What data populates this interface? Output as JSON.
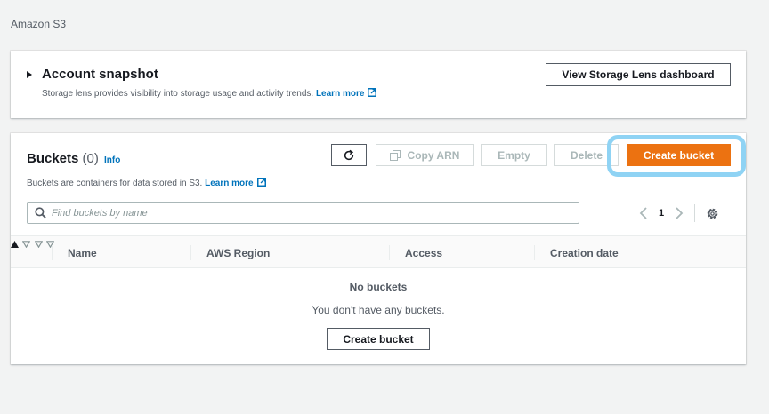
{
  "breadcrumb": "Amazon S3",
  "snapshot": {
    "title": "Account snapshot",
    "description": "Storage lens provides visibility into storage usage and activity trends.",
    "learn_more": "Learn more",
    "dashboard_button": "View Storage Lens dashboard"
  },
  "buckets": {
    "title": "Buckets",
    "count": "(0)",
    "info": "Info",
    "description": "Buckets are containers for data stored in S3.",
    "learn_more": "Learn more",
    "toolbar": {
      "refresh_icon": "refresh-icon",
      "copy_arn": "Copy ARN",
      "empty": "Empty",
      "delete": "Delete",
      "create_bucket": "Create bucket"
    },
    "search_placeholder": "Find buckets by name",
    "pagination": {
      "current_page": "1"
    },
    "columns": [
      "Name",
      "AWS Region",
      "Access",
      "Creation date"
    ],
    "empty_title": "No buckets",
    "empty_description": "You don't have any buckets.",
    "empty_create_button": "Create bucket"
  },
  "colors": {
    "primary": "#ec7211",
    "link": "#0073bb",
    "highlight": "#8fd3f4"
  }
}
